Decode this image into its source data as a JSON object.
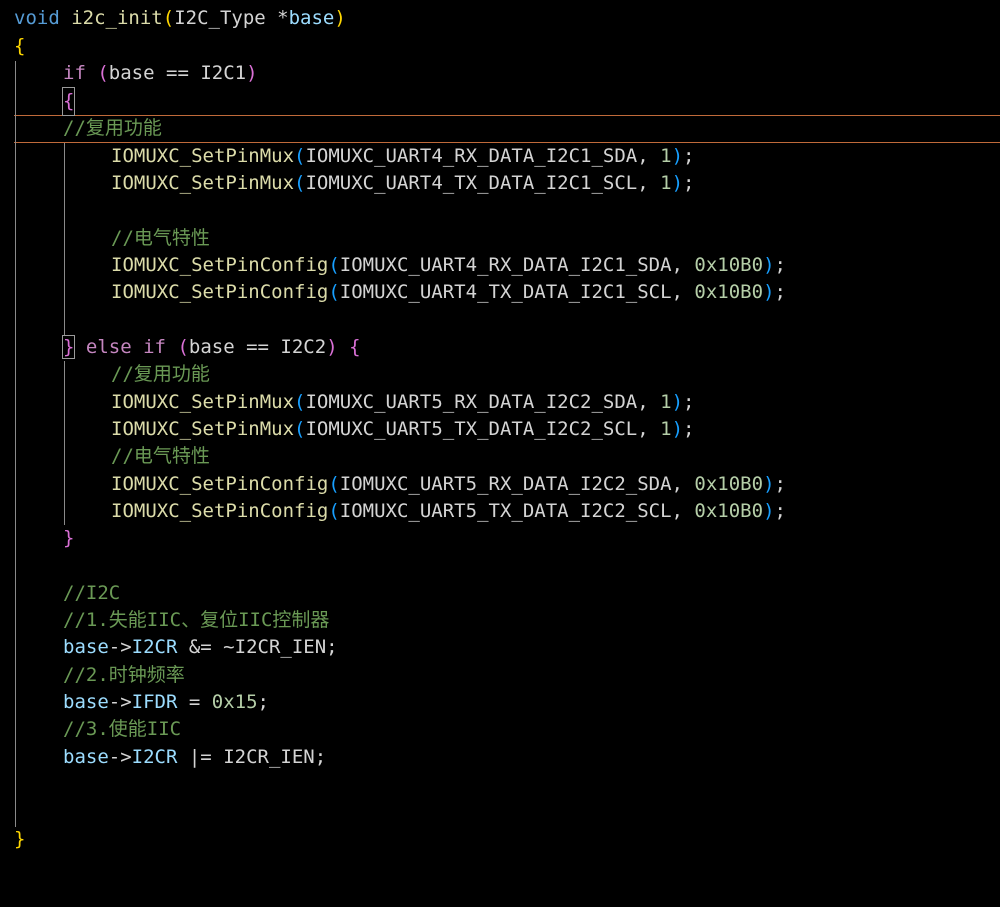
{
  "code": {
    "l1": {
      "kw": "void",
      "fn": "i2c_init",
      "p1": "(",
      "type": "I2C_Type",
      "op": " *",
      "var": "base",
      "p2": ")"
    },
    "l2": {
      "b": "{"
    },
    "l3": {
      "kw": "if",
      "p1": "(",
      "var": "base",
      "op": " == ",
      "c": "I2C1",
      "p2": ")"
    },
    "l4": {
      "b": "{"
    },
    "l5": {
      "cmt": "//复用功能"
    },
    "l6": {
      "fn": "IOMUXC_SetPinMux",
      "p1": "(",
      "arg": "IOMUXC_UART4_RX_DATA_I2C1_SDA",
      "sep": ", ",
      "num": "1",
      "p2": ")",
      "end": ";"
    },
    "l7": {
      "fn": "IOMUXC_SetPinMux",
      "p1": "(",
      "arg": "IOMUXC_UART4_TX_DATA_I2C1_SCL",
      "sep": ", ",
      "num": "1",
      "p2": ")",
      "end": ";"
    },
    "l9": {
      "cmt": "//电气特性"
    },
    "l10": {
      "fn": "IOMUXC_SetPinConfig",
      "p1": "(",
      "arg": "IOMUXC_UART4_RX_DATA_I2C1_SDA",
      "sep": ", ",
      "num": "0x10B0",
      "p2": ")",
      "end": ";"
    },
    "l11": {
      "fn": "IOMUXC_SetPinConfig",
      "p1": "(",
      "arg": "IOMUXC_UART4_TX_DATA_I2C1_SCL",
      "sep": ", ",
      "num": "0x10B0",
      "p2": ")",
      "end": ";"
    },
    "l13": {
      "b1": "}",
      "kw": "else if",
      "p1": "(",
      "var": "base",
      "op": " == ",
      "c": "I2C2",
      "p2": ")",
      "b2": "{"
    },
    "l14": {
      "cmt": "//复用功能"
    },
    "l15": {
      "fn": "IOMUXC_SetPinMux",
      "p1": "(",
      "arg": "IOMUXC_UART5_RX_DATA_I2C2_SDA",
      "sep": ", ",
      "num": "1",
      "p2": ")",
      "end": ";"
    },
    "l16": {
      "fn": "IOMUXC_SetPinMux",
      "p1": "(",
      "arg": "IOMUXC_UART5_TX_DATA_I2C2_SCL",
      "sep": ", ",
      "num": "1",
      "p2": ")",
      "end": ";"
    },
    "l17": {
      "cmt": "//电气特性"
    },
    "l18": {
      "fn": "IOMUXC_SetPinConfig",
      "p1": "(",
      "arg": "IOMUXC_UART5_RX_DATA_I2C2_SDA",
      "sep": ", ",
      "num": "0x10B0",
      "p2": ")",
      "end": ";"
    },
    "l19": {
      "fn": "IOMUXC_SetPinConfig",
      "p1": "(",
      "arg": "IOMUXC_UART5_TX_DATA_I2C2_SCL",
      "sep": ", ",
      "num": "0x10B0",
      "p2": ")",
      "end": ";"
    },
    "l20": {
      "b": "}"
    },
    "l22": {
      "cmt": "//I2C"
    },
    "l23": {
      "cmt": "//1.失能IIC、复位IIC控制器"
    },
    "l24": {
      "var": "base",
      "arrow": "->",
      "field": "I2CR",
      "op": " &= ~",
      "c": "I2CR_IEN",
      "end": ";"
    },
    "l25": {
      "cmt": "//2.时钟频率"
    },
    "l26": {
      "var": "base",
      "arrow": "->",
      "field": "IFDR",
      "op": " = ",
      "num": "0x15",
      "end": ";"
    },
    "l27": {
      "cmt": "//3.使能IIC"
    },
    "l28": {
      "var": "base",
      "arrow": "->",
      "field": "I2CR",
      "op": " |= ",
      "c": "I2CR_IEN",
      "end": ";"
    },
    "l31": {
      "b": "}"
    }
  }
}
